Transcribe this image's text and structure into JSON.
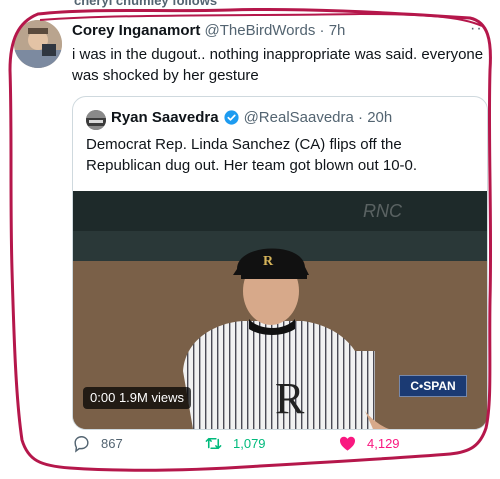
{
  "social_context": "cheryl chumley follows",
  "tweet": {
    "author_name": "Corey Inganamort",
    "author_handle": "@TheBirdWords",
    "time_ago": "7h",
    "text": "i was in the dugout.. nothing inappropriate was said. everyone was shocked by her gesture"
  },
  "quote": {
    "author_name": "Ryan Saavedra",
    "author_handle": "@RealSaavedra",
    "time_ago": "20h",
    "text": "Democrat Rep. Linda Sanchez (CA) flips off the Republican dug out. Her team got blown out 10-0.",
    "video": {
      "timestamp": "0:00",
      "views": "1.9M views",
      "network_logo_text": "C•SPAN",
      "wall_text": "RNC"
    }
  },
  "actions": {
    "reply_count": "867",
    "retweet_count": "1,079",
    "like_count": "4,129"
  },
  "colors": {
    "scribble": "#b5174b",
    "retweet": "#00ba7c",
    "like": "#f91880",
    "verified": "#1d9bf0",
    "muted": "#536471"
  },
  "icons": [
    "more-icon",
    "verified-badge-icon",
    "reply-icon",
    "retweet-icon",
    "like-icon"
  ]
}
